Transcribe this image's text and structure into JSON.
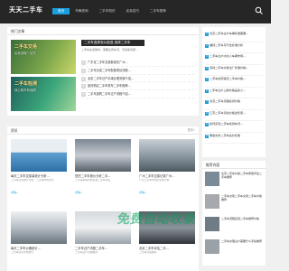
{
  "site": {
    "logo": "天天二手车"
  },
  "nav": [
    {
      "label": "首页",
      "active": true
    },
    {
      "label": "车辆咨询",
      "active": false
    },
    {
      "label": "二手车知识",
      "active": false
    },
    {
      "label": "买卖技巧",
      "active": false
    },
    {
      "label": "二手车推荐",
      "active": false
    }
  ],
  "hot": {
    "title": "热门文章",
    "images": [
      {
        "cap1": "二手车交易",
        "cap2": "买卖流程一站式"
      },
      {
        "cap1": "二手车检测",
        "cap2": "放心购车有保障"
      }
    ],
    "top_title": "二手车选择怎么挑选 选择二手车",
    "top_desc": "二手车在选购时，需要注意车况、手续等问题...",
    "items": [
      "广东省二手车交易数量在广州...",
      "二手车交易二手车配置项目流程...",
      "北京二手车过户手续办理流程介绍...",
      "如何购买二手车现车二手车推荐...",
      "二手车选购二手车过户流程介绍..."
    ]
  },
  "rlist": {
    "items": [
      "北京二手车过户车辆标准需要...",
      "福特二手车可行性标准分析",
      "二手车过户中太人车辆市场...",
      "深圳二手车交易出厂标准价格...",
      "二手车如何鉴定二手车价格...",
      "二手车过户上牌价格是多少...",
      "北京二手车流程检测价格",
      "江苏二手车评估价格出售表...",
      "如何买到二手车检测车况...",
      "哪些省市二手车估价标准"
    ]
  },
  "reco": {
    "title": "推荐内容",
    "items": [
      "北京二手车价格二手车质量评估二手车推荐",
      "二手车交易二手车交易二手车价格推荐",
      "二手车流程买卖二手车推荐价格",
      "二手车办理过户需要什么手续推荐"
    ]
  },
  "grid": {
    "title": "资讯",
    "more": "更多»",
    "cards": [
      {
        "t": "每天二手车交易量统计分析...",
        "d": "二手车交易统计分析，二手车市场交易",
        "m": "详情»"
      },
      {
        "t": "您的二手车报价分析二手...",
        "d": "二手车车辆价格标准二手车评估",
        "m": "详情»"
      },
      {
        "t": "广州二手车交易记录广州...",
        "d": "广州二手车市场交易量分析",
        "m": "详情»"
      },
      {
        "t": "每天二手车价格统计...",
        "d": "二手车交易市场统计",
        "m": "详情»"
      },
      {
        "t": "二手车过户流程二手车...",
        "d": "二手车过户流程推荐",
        "m": "详情»"
      },
      {
        "t": "北京二手车评估二手...",
        "d": "二手车评估推荐",
        "m": "详情»"
      }
    ]
  },
  "watermark": "免费自动收录",
  "colors": {
    "accent": "#1a9fdc",
    "topbar": "#262626"
  }
}
